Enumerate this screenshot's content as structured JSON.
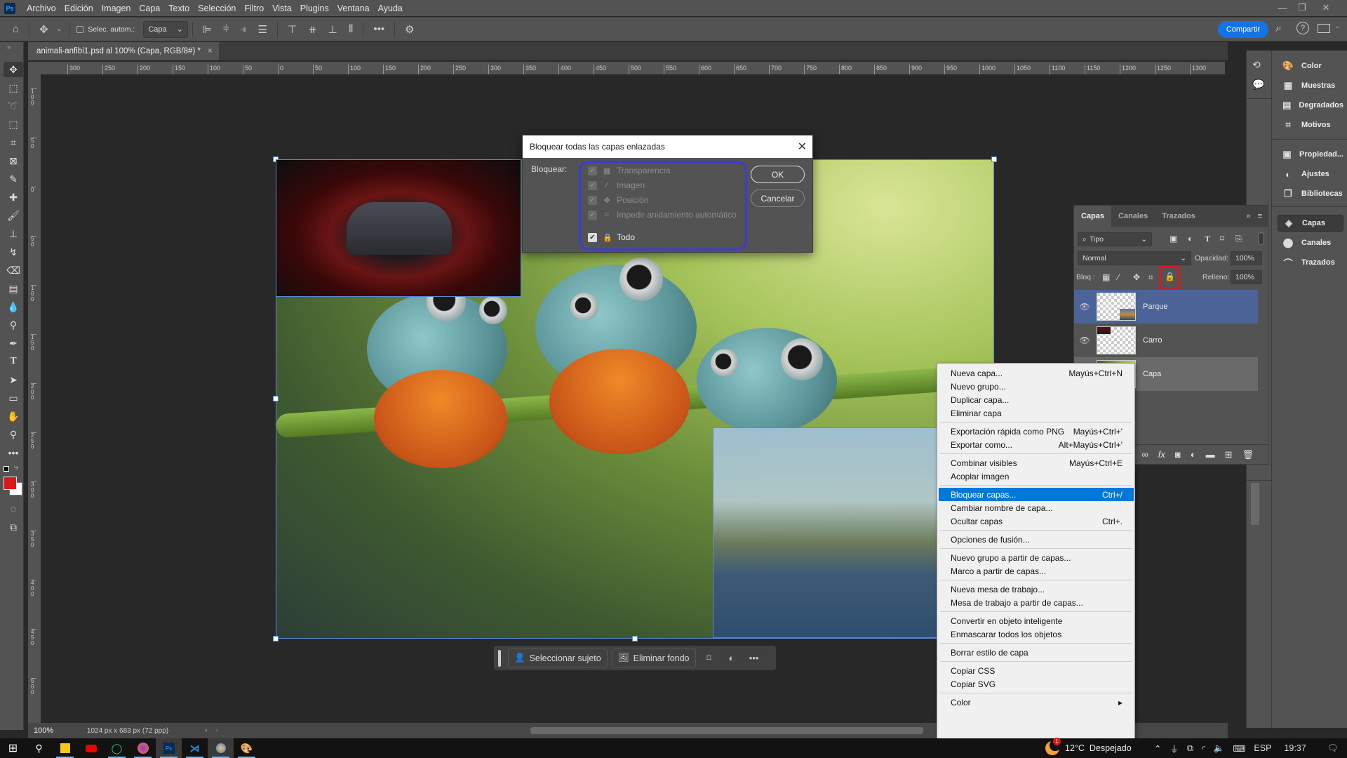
{
  "app": {
    "logo": "Ps",
    "menu": [
      "Archivo",
      "Edición",
      "Imagen",
      "Capa",
      "Texto",
      "Selección",
      "Filtro",
      "Vista",
      "Plugins",
      "Ventana",
      "Ayuda"
    ],
    "window_controls": {
      "minimize": "—",
      "restore": "❐",
      "close": "✕"
    }
  },
  "options_bar": {
    "auto_select_label": "Selec. autom.:",
    "auto_select_checked": false,
    "auto_select_target": "Capa",
    "share_label": "Compartir"
  },
  "document": {
    "tab_title": "animali-anfibi1.psd al 100% (Capa, RGB/8#) *",
    "zoom": "100%",
    "info": "1024 px x 683 px (72 ppp)",
    "ruler_h": [
      "300",
      "250",
      "200",
      "150",
      "100",
      "50",
      "0",
      "50",
      "100",
      "150",
      "200",
      "250",
      "300",
      "350",
      "400",
      "450",
      "500",
      "550",
      "600",
      "650",
      "700",
      "750",
      "800",
      "850",
      "900",
      "950",
      "1000",
      "1050",
      "1100",
      "1150",
      "1200",
      "1250",
      "1300",
      "13"
    ],
    "ruler_v": [
      "100",
      "50",
      "0",
      "50",
      "100",
      "150",
      "200",
      "250",
      "300",
      "350",
      "400",
      "450",
      "500"
    ]
  },
  "tools": [
    "move",
    "marquee",
    "lasso",
    "object-select",
    "crop",
    "frame",
    "eyedropper",
    "healing",
    "brush",
    "stamp",
    "history-brush",
    "eraser",
    "gradient",
    "blur",
    "dodge",
    "pen",
    "type",
    "path-select",
    "rectangle",
    "hand",
    "zoom",
    "more"
  ],
  "colors": {
    "foreground": "#d9181c",
    "background": "#ffffff",
    "accent": "#1473e6",
    "highlight": "#0078d7",
    "lock_annotation": "#e81123",
    "dialog_annotation": "#3b3bd6"
  },
  "dialog": {
    "title": "Bloquear todas las capas enlazadas",
    "lock_label": "Bloquear:",
    "options": [
      {
        "label": "Transparencia",
        "icon": "checker-icon",
        "checked": true,
        "disabled": true
      },
      {
        "label": "Imagen",
        "icon": "brush-icon",
        "checked": true,
        "disabled": true
      },
      {
        "label": "Posición",
        "icon": "move-icon",
        "checked": true,
        "disabled": true
      },
      {
        "label": "Impedir anidamiento automático",
        "icon": "artboard-icon",
        "checked": true,
        "disabled": true
      },
      {
        "label": "Todo",
        "icon": "lock-icon",
        "checked": true,
        "disabled": false
      }
    ],
    "ok_label": "OK",
    "cancel_label": "Cancelar"
  },
  "contextual_taskbar": {
    "select_subject": "Seleccionar sujeto",
    "remove_bg": "Eliminar fondo"
  },
  "layers_panel": {
    "tabs": [
      "Capas",
      "Canales",
      "Trazados"
    ],
    "active_tab": "Capas",
    "filter_label": "Tipo",
    "blend_mode": "Normal",
    "opacity_label": "Opacidad:",
    "opacity": "100%",
    "lock_label": "Bloq.:",
    "fill_label": "Relleno:",
    "fill": "100%",
    "layers": [
      {
        "name": "Parque",
        "visible": true,
        "selected": true
      },
      {
        "name": "Carro",
        "visible": true,
        "selected": false
      },
      {
        "name": "Capa",
        "visible": false,
        "selected": false,
        "active": true
      }
    ]
  },
  "dock": {
    "group1": [
      "Color",
      "Muestras",
      "Degradados",
      "Motivos"
    ],
    "group2": [
      "Propiedad...",
      "Ajustes",
      "Bibliotecas"
    ],
    "group3": [
      "Capas",
      "Canales",
      "Trazados"
    ],
    "active": "Capas"
  },
  "context_menu": {
    "groups": [
      [
        {
          "label": "Nueva capa...",
          "shortcut": "Mayús+Ctrl+N"
        },
        {
          "label": "Nuevo grupo...",
          "shortcut": ""
        },
        {
          "label": "Duplicar capa...",
          "shortcut": ""
        },
        {
          "label": "Eliminar capa",
          "shortcut": ""
        }
      ],
      [
        {
          "label": "Exportación rápida como PNG",
          "shortcut": "Mayús+Ctrl+'"
        },
        {
          "label": "Exportar como...",
          "shortcut": "Alt+Mayús+Ctrl+'"
        }
      ],
      [
        {
          "label": "Combinar visibles",
          "shortcut": "Mayús+Ctrl+E"
        },
        {
          "label": "Acoplar imagen",
          "shortcut": ""
        }
      ],
      [
        {
          "label": "Bloquear capas...",
          "shortcut": "Ctrl+/",
          "highlighted": true
        },
        {
          "label": "Cambiar nombre de capa...",
          "shortcut": ""
        },
        {
          "label": "Ocultar capas",
          "shortcut": "Ctrl+."
        }
      ],
      [
        {
          "label": "Opciones de fusión...",
          "shortcut": ""
        }
      ],
      [
        {
          "label": "Nuevo grupo a partir de capas...",
          "shortcut": ""
        },
        {
          "label": "Marco a partir de capas...",
          "shortcut": ""
        }
      ],
      [
        {
          "label": "Nueva mesa de trabajo...",
          "shortcut": ""
        },
        {
          "label": "Mesa de trabajo a partir de capas...",
          "shortcut": ""
        }
      ],
      [
        {
          "label": "Convertir en objeto inteligente",
          "shortcut": ""
        },
        {
          "label": "Enmascarar todos los objetos",
          "shortcut": ""
        }
      ],
      [
        {
          "label": "Borrar estilo de capa",
          "shortcut": ""
        }
      ],
      [
        {
          "label": "Copiar CSS",
          "shortcut": ""
        },
        {
          "label": "Copiar SVG",
          "shortcut": ""
        }
      ],
      [
        {
          "label": "Color",
          "shortcut": "▸"
        }
      ]
    ]
  },
  "taskbar": {
    "apps": [
      "start",
      "search",
      "sticky-notes",
      "youtube",
      "whatsapp",
      "firefox",
      "photoshop",
      "vscode",
      "app-blue",
      "paint"
    ],
    "weather": "12°C  Despejado",
    "weather_badge": "1",
    "language": "ESP",
    "time": "19:37"
  }
}
